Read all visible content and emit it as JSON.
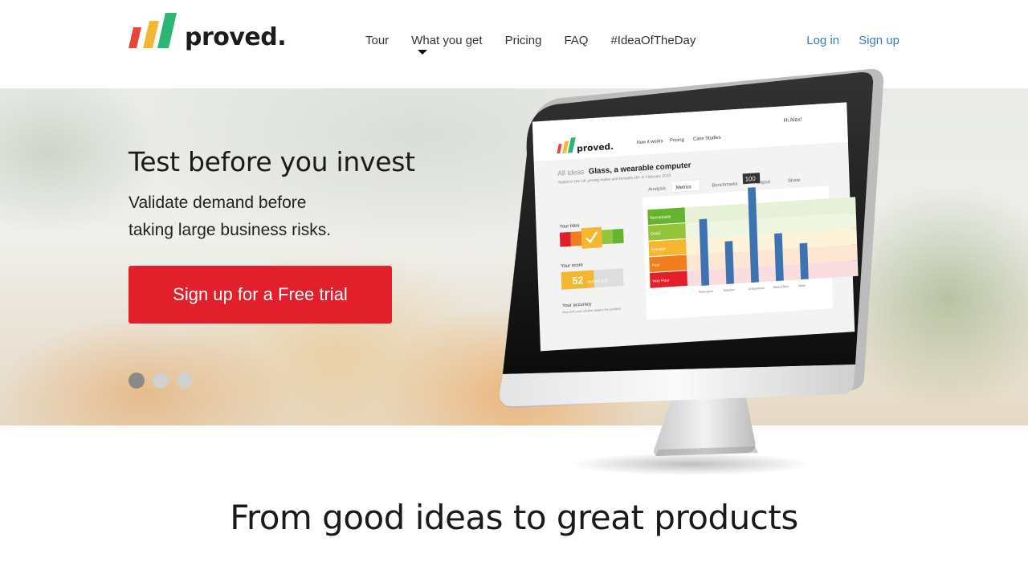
{
  "brand": {
    "name": "proved.",
    "colors": [
      "#e8463c",
      "#f5b731",
      "#2bb673"
    ]
  },
  "nav": {
    "items": [
      "Tour",
      "What you get",
      "Pricing",
      "FAQ",
      "#IdeaOfTheDay"
    ]
  },
  "auth": {
    "login": "Log in",
    "signup": "Sign up"
  },
  "hero": {
    "title": "Test before you invest",
    "subtitle_line1": "Validate demand before",
    "subtitle_line2": "taking large business risks.",
    "cta": "Sign up for a Free trial",
    "slides": 3,
    "active_slide": 1
  },
  "screen": {
    "nav": [
      "How it works",
      "Pricing",
      "Case Studies"
    ],
    "user": "Hi Alex!",
    "ideas_label": "All Ideas",
    "idea_title": "Glass, a wearable computer",
    "idea_sub": "Tested in the UK among males and females 18+ in February 2013",
    "tabs": [
      "Analysis",
      "Metrics",
      "Benchmarks",
      "Export",
      "Share"
    ],
    "your_idea": "Your Idea",
    "your_score": "Your score",
    "score": "52",
    "score_suffix": "out of 100",
    "your_accuracy": "Your accuracy",
    "accuracy_note": "How well your solution targets the problem",
    "rating_levels": [
      "Remarkable",
      "Good",
      "Average",
      "Poor",
      "Very Poor"
    ],
    "bar_tooltip": "100",
    "bar_labels": [
      "Relevance",
      "Solution",
      "Uniqueness",
      "Wow Effect",
      "Value"
    ],
    "bar_values": [
      70,
      45,
      100,
      50,
      38
    ]
  },
  "footer": {
    "title": "From good ideas to great products"
  }
}
